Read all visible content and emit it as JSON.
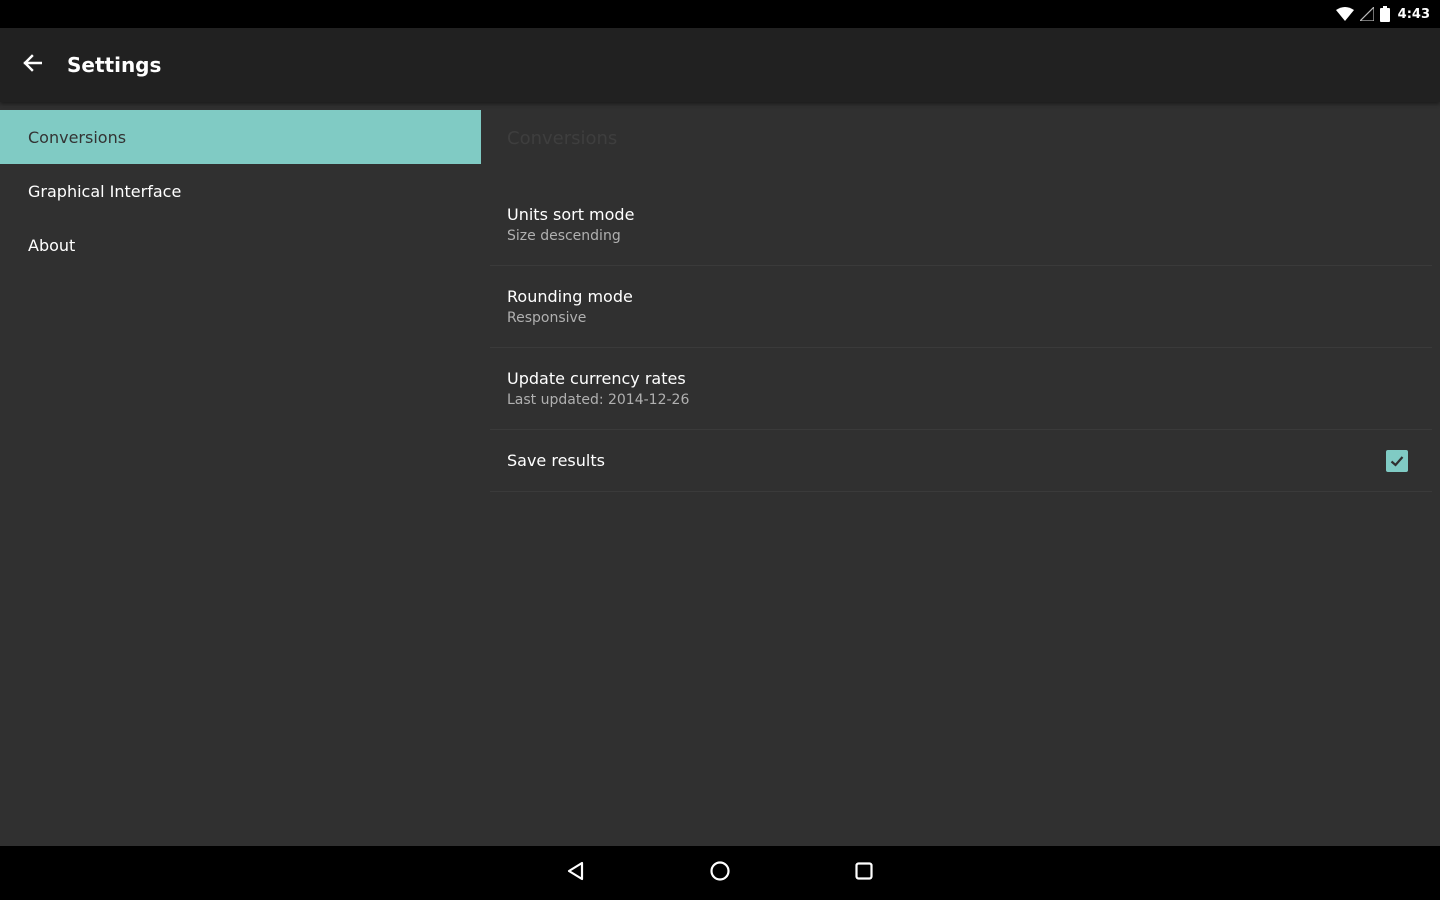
{
  "status_bar": {
    "time": "4:43",
    "icons": [
      "wifi-icon",
      "signal-icon",
      "battery-icon"
    ]
  },
  "app_bar": {
    "title": "Settings",
    "back_icon": "arrow-back-icon"
  },
  "sidebar": {
    "items": [
      {
        "label": "Conversions",
        "active": true
      },
      {
        "label": "Graphical Interface",
        "active": false
      },
      {
        "label": "About",
        "active": false
      }
    ]
  },
  "detail": {
    "category": "Conversions",
    "prefs": [
      {
        "title": "Units sort mode",
        "summary": "Size descending"
      },
      {
        "title": "Rounding mode",
        "summary": "Responsive"
      },
      {
        "title": "Update currency rates",
        "summary": "Last updated: 2014-12-26"
      },
      {
        "title": "Save results",
        "checked": true
      }
    ]
  },
  "nav_bar": {
    "icons": [
      "back-triangle-icon",
      "home-circle-icon",
      "recents-square-icon"
    ]
  },
  "colors": {
    "accent": "#80cbc4",
    "app_bar": "#212121",
    "background": "#303030"
  }
}
